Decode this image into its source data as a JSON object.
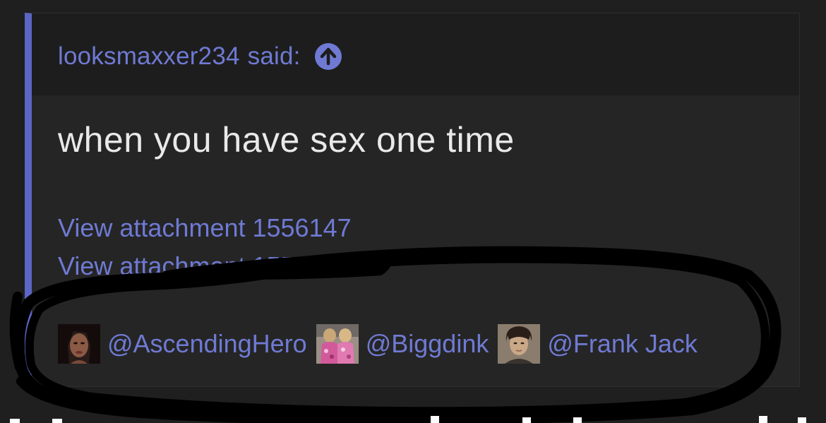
{
  "quote": {
    "author": "looksmaxxer234",
    "said_label": "said:",
    "jump_icon": "arrow-up-circle-icon",
    "body_text": "when you have sex one time",
    "attachments": [
      "View attachment 1556147",
      "View attachment 1556"
    ],
    "mentions": [
      {
        "name": "@AscendingHero",
        "avatar": "avatar-dark-hair-woman"
      },
      {
        "name": "@Biggdink",
        "avatar": "avatar-pink-outfits-pair"
      },
      {
        "name": "@Frank Jack",
        "avatar": "avatar-dark-hair-man"
      }
    ]
  },
  "colors": {
    "page_bg": "#1f1f1f",
    "quote_bg": "#252525",
    "header_bg": "#1d1d1d",
    "accent_border": "#5c66c4",
    "link": "#6f7ad3",
    "text": "#e9e9e9",
    "scribble": "#000000"
  }
}
